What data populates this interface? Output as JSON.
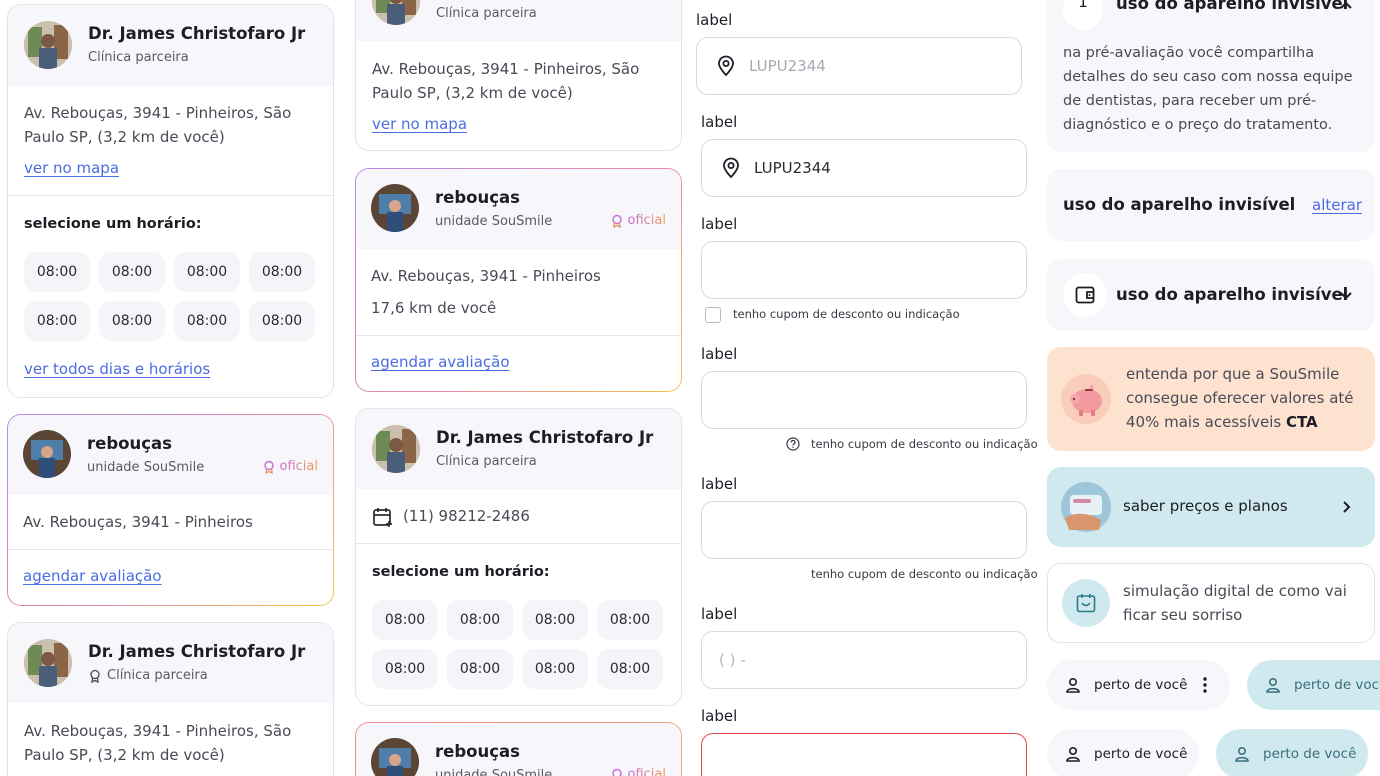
{
  "col1": {
    "card1": {
      "name": "Dr. James Christofaro Jr",
      "type": "Clínica parceira",
      "address": "Av. Rebouças, 3941 - Pinheiros, São Paulo SP, (3,2 km de você)",
      "map_link": "ver no mapa",
      "select_label": "selecione um horário:",
      "slots": [
        "08:00",
        "08:00",
        "08:00",
        "08:00",
        "08:00",
        "08:00",
        "08:00",
        "08:00"
      ],
      "all_link": "ver todos dias e horários"
    },
    "card2": {
      "name": "rebouças",
      "type": "unidade SouSmile",
      "badge": "oficial",
      "address": "Av. Rebouças, 3941 - Pinheiros",
      "cta": "agendar avaliação"
    },
    "card3": {
      "name": "Dr. James Christofaro Jr",
      "type": "Clínica parceira",
      "address": "Av. Rebouças, 3941 - Pinheiros, São Paulo SP, (3,2 km de você)"
    }
  },
  "col2": {
    "card1": {
      "type": "Clínica parceira",
      "address": "Av. Rebouças, 3941 - Pinheiros, São Paulo SP, (3,2 km de você)",
      "map_link": "ver no mapa"
    },
    "card2": {
      "name": "rebouças",
      "type": "unidade SouSmile",
      "badge": "oficial",
      "address": "Av. Rebouças, 3941 - Pinheiros",
      "distance": "17,6 km de você",
      "cta": "agendar avaliação"
    },
    "card3": {
      "name": "Dr. James Christofaro Jr",
      "type": "Clínica parceira",
      "phone": "(11) 98212-2486",
      "select_label": "selecione um horário:",
      "slots": [
        "08:00",
        "08:00",
        "08:00",
        "08:00",
        "08:00",
        "08:00",
        "08:00",
        "08:00"
      ]
    },
    "card4": {
      "name": "rebouças",
      "type": "unidade SouSmile",
      "badge": "oficial"
    }
  },
  "form": {
    "labels": [
      "label",
      "label",
      "label",
      "label",
      "label",
      "label",
      "label"
    ],
    "field1_value": "LUPU2344",
    "field2_value": "LUPU2344",
    "coupon": "tenho cupom de desconto ou indicação",
    "phone_placeholder": "( ) -"
  },
  "right": {
    "acc_open": {
      "step": "1",
      "title": "uso do aparelho invisível",
      "body": "na pré-avaliação você compartilha detalhes do seu caso com nossa equipe de dentistas, para receber um pré-diagnóstico e o preço do tratamento."
    },
    "acc_summary": {
      "title": "uso do aparelho invisível",
      "action": "alterar"
    },
    "acc_closed": {
      "title": "uso do aparelho invisível"
    },
    "promo": {
      "text": "entenda por que a SouSmile consegue oferecer valores até 40% mais acessíveis ",
      "cta": "CTA"
    },
    "pricing": {
      "text": "saber preços e planos"
    },
    "sim": {
      "text": "simulação digital de como vai ficar seu sorriso"
    },
    "chips": [
      "perto de você",
      "perto de você",
      "perto de você",
      "perto de você"
    ]
  }
}
